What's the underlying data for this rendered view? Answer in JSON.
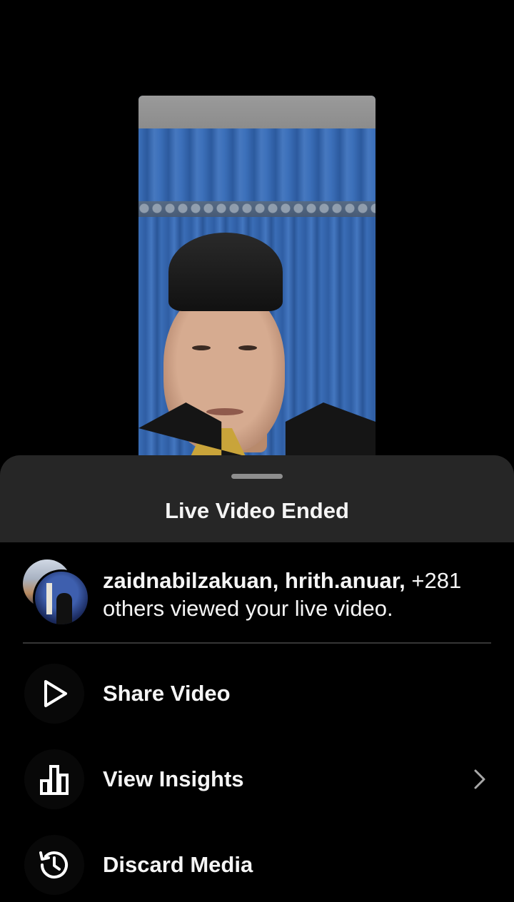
{
  "sheet": {
    "title": "Live Video Ended"
  },
  "viewers": {
    "names": "zaidnabilzakuan, hrith.anuar,",
    "rest": " +281 others viewed your live video."
  },
  "actions": [
    {
      "label": "Share Video",
      "icon": "play-icon"
    },
    {
      "label": "View Insights",
      "icon": "bar-chart-icon"
    },
    {
      "label": "Discard Media",
      "icon": "history-icon"
    }
  ],
  "colors": {
    "background": "#000000",
    "sheet_header": "#262626",
    "divider": "#363636",
    "text": "#f5f5f5"
  }
}
